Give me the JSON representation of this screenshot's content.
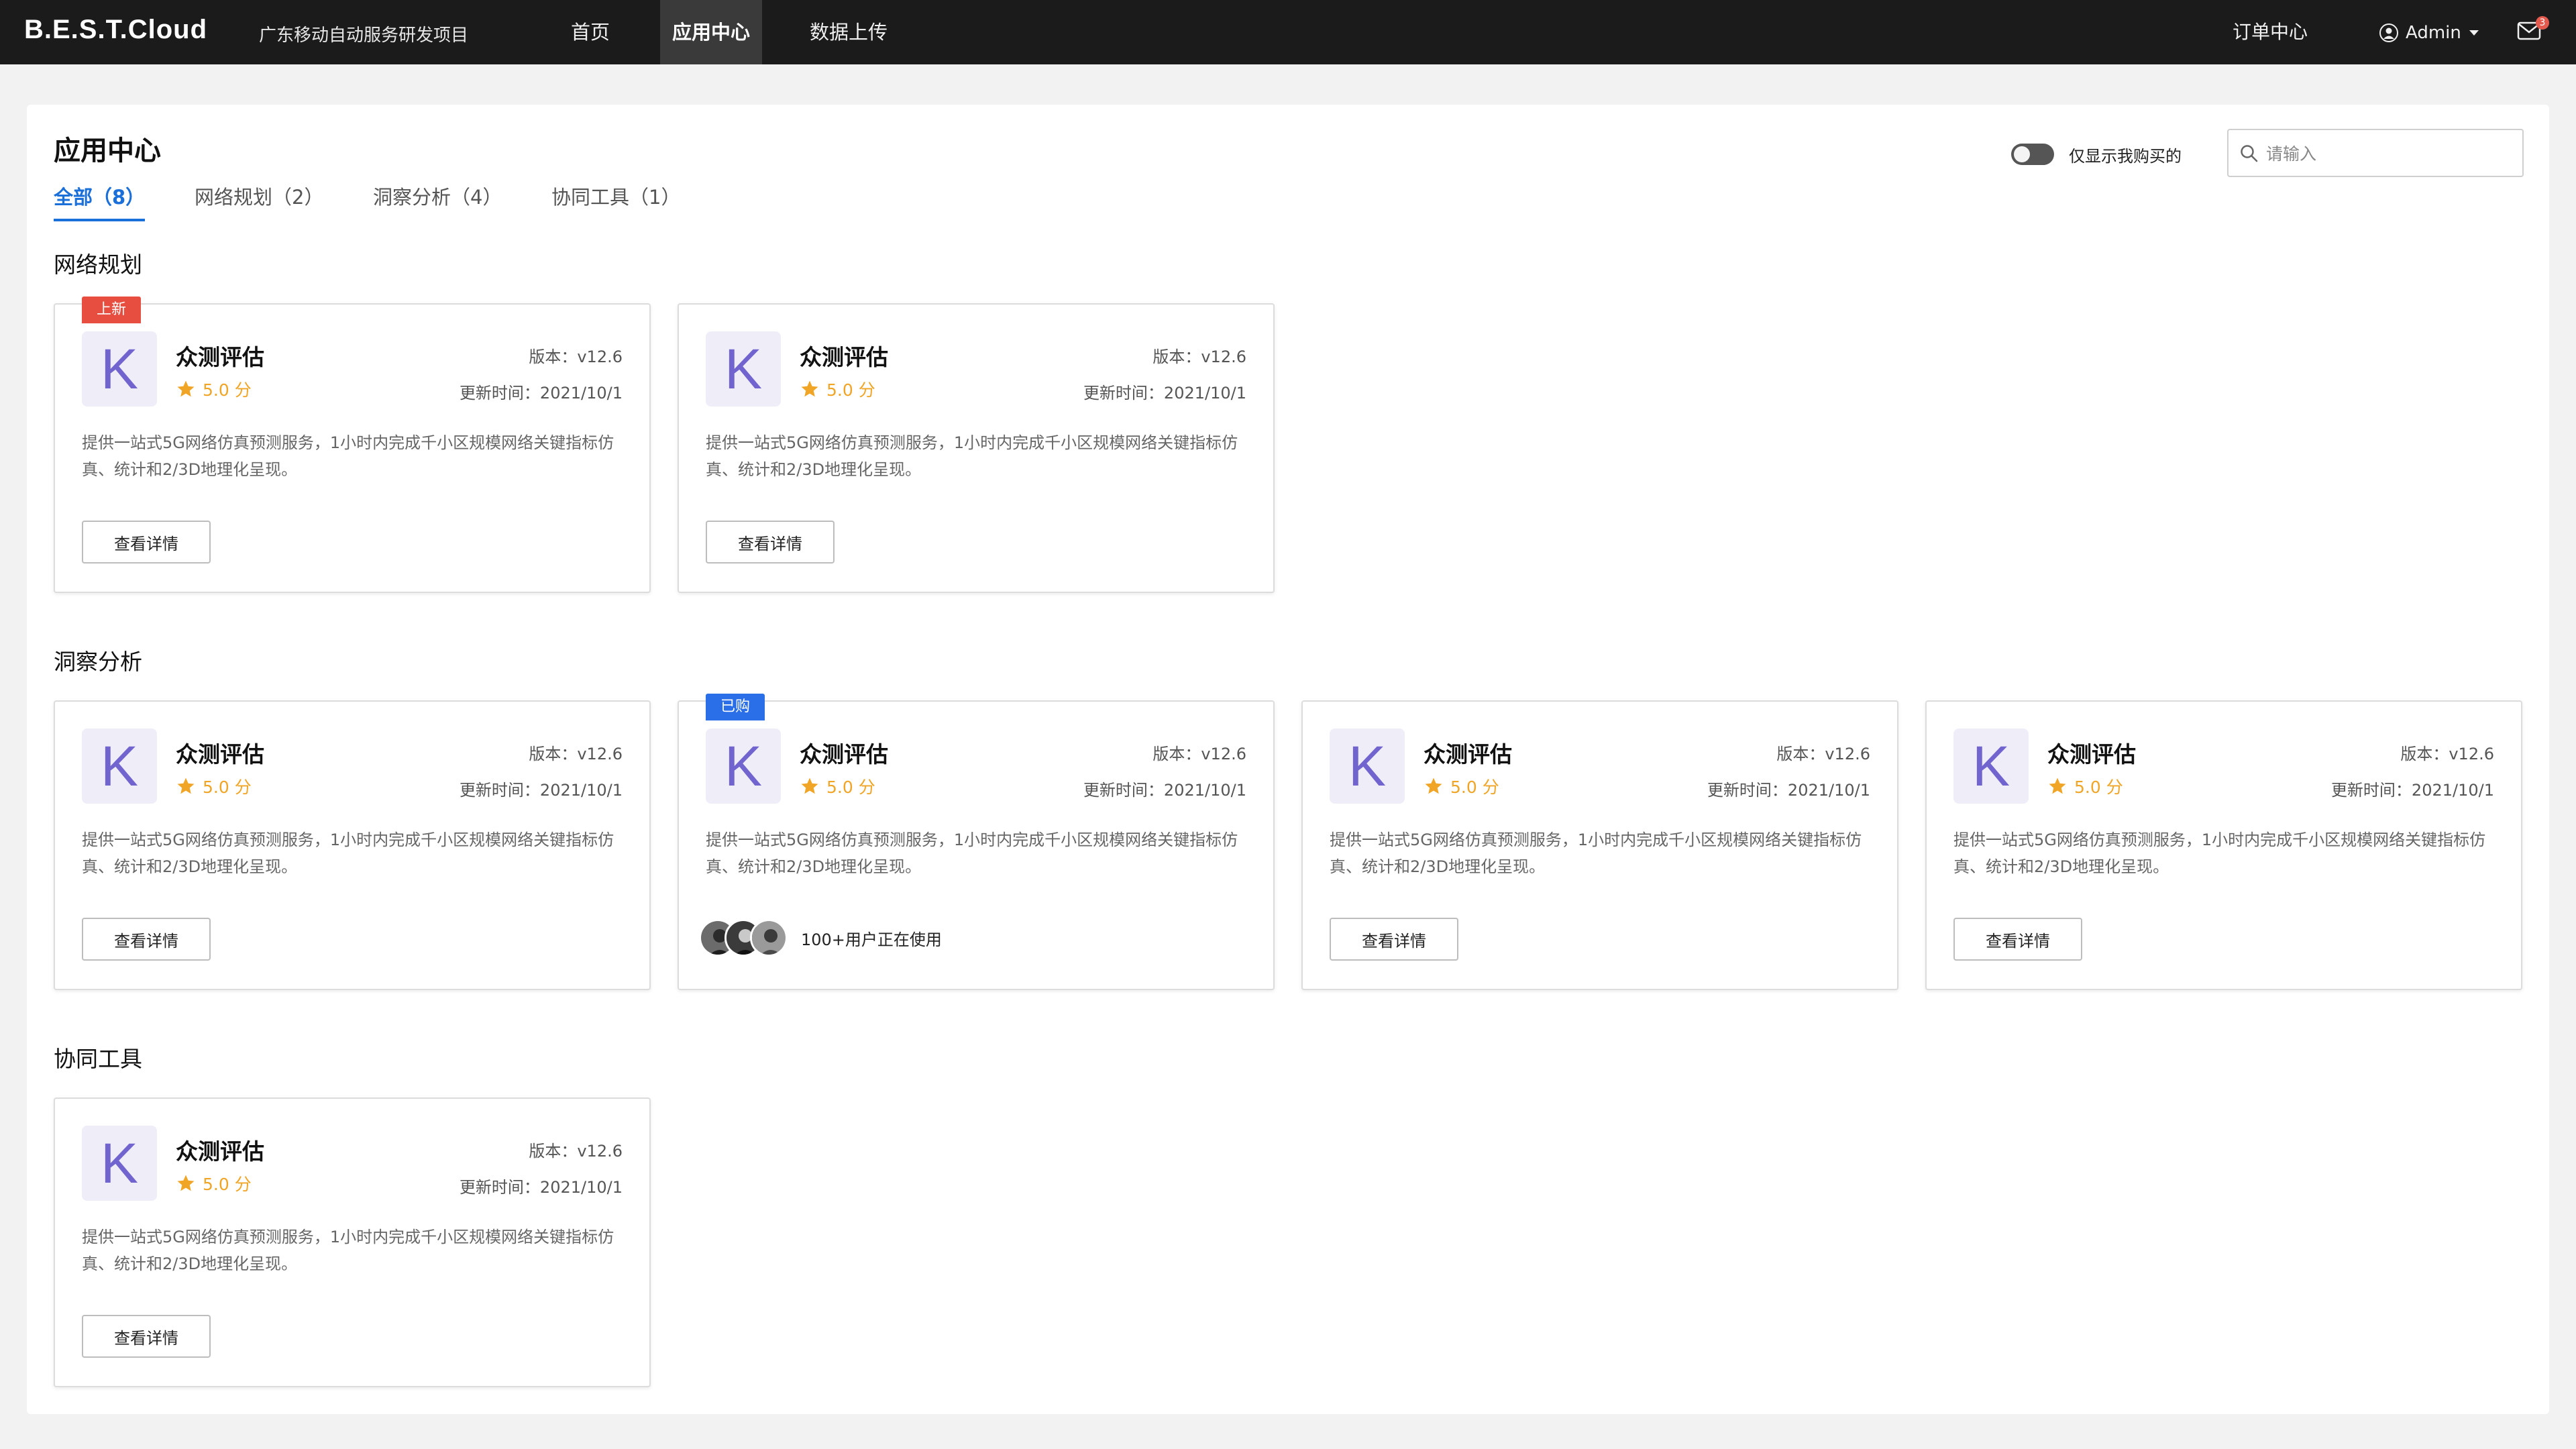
{
  "nav": {
    "brand": "B.E.S.T.Cloud",
    "project": "广东移动自动服务研发项目",
    "items": [
      {
        "label": "首页"
      },
      {
        "label": "应用中心"
      },
      {
        "label": "数据上传"
      }
    ],
    "orders": "订单中心",
    "user": "Admin",
    "mail_count": "3"
  },
  "page": {
    "title": "应用中心",
    "tabs": [
      {
        "label": "全部（8）"
      },
      {
        "label": "网络规划（2）"
      },
      {
        "label": "洞察分析（4）"
      },
      {
        "label": "协同工具（1）"
      }
    ],
    "toggle_label": "仅显示我购买的",
    "search_placeholder": "请输入"
  },
  "sections": [
    {
      "title": "网络规划",
      "cards": [
        {
          "badge": "上新",
          "logo": "K",
          "name": "众测评估",
          "rating": "5.0 分",
          "version": "版本：v12.6",
          "updated": "更新时间：2021/10/1",
          "desc": "提供一站式5G网络仿真预测服务，1小时内完成千小区规模网络关键指标仿真、统计和2/3D地理化呈现。",
          "button": "查看详情"
        },
        {
          "logo": "K",
          "name": "众测评估",
          "rating": "5.0 分",
          "version": "版本：v12.6",
          "updated": "更新时间：2021/10/1",
          "desc": "提供一站式5G网络仿真预测服务，1小时内完成千小区规模网络关键指标仿真、统计和2/3D地理化呈现。",
          "button": "查看详情"
        }
      ]
    },
    {
      "title": "洞察分析",
      "cards": [
        {
          "logo": "K",
          "name": "众测评估",
          "rating": "5.0 分",
          "version": "版本：v12.6",
          "updated": "更新时间：2021/10/1",
          "desc": "提供一站式5G网络仿真预测服务，1小时内完成千小区规模网络关键指标仿真、统计和2/3D地理化呈现。",
          "button": "查看详情"
        },
        {
          "badge": "已购",
          "logo": "K",
          "name": "众测评估",
          "rating": "5.0 分",
          "version": "版本：v12.6",
          "updated": "更新时间：2021/10/1",
          "desc": "提供一站式5G网络仿真预测服务，1小时内完成千小区规模网络关键指标仿真、统计和2/3D地理化呈现。",
          "users_text": "100+用户正在使用"
        },
        {
          "logo": "K",
          "name": "众测评估",
          "rating": "5.0 分",
          "version": "版本：v12.6",
          "updated": "更新时间：2021/10/1",
          "desc": "提供一站式5G网络仿真预测服务，1小时内完成千小区规模网络关键指标仿真、统计和2/3D地理化呈现。",
          "button": "查看详情"
        },
        {
          "logo": "K",
          "name": "众测评估",
          "rating": "5.0 分",
          "version": "版本：v12.6",
          "updated": "更新时间：2021/10/1",
          "desc": "提供一站式5G网络仿真预测服务，1小时内完成千小区规模网络关键指标仿真、统计和2/3D地理化呈现。",
          "button": "查看详情"
        }
      ]
    },
    {
      "title": "协同工具",
      "cards": [
        {
          "logo": "K",
          "name": "众测评估",
          "rating": "5.0 分",
          "version": "版本：v12.6",
          "updated": "更新时间：2021/10/1",
          "desc": "提供一站式5G网络仿真预测服务，1小时内完成千小区规模网络关键指标仿真、统计和2/3D地理化呈现。",
          "button": "查看详情"
        }
      ]
    }
  ],
  "icons": {
    "star": "star-icon",
    "search": "search-icon",
    "user": "user-circle-icon",
    "mail": "mail-icon",
    "caret": "caret-down-icon"
  },
  "colors": {
    "accent": "#1a6fd8",
    "badge_new": "#e84e40",
    "badge_bought": "#2a6fe8",
    "star": "#f0a526",
    "logo_text": "#7264cf",
    "topbar": "#1b1b1b"
  }
}
